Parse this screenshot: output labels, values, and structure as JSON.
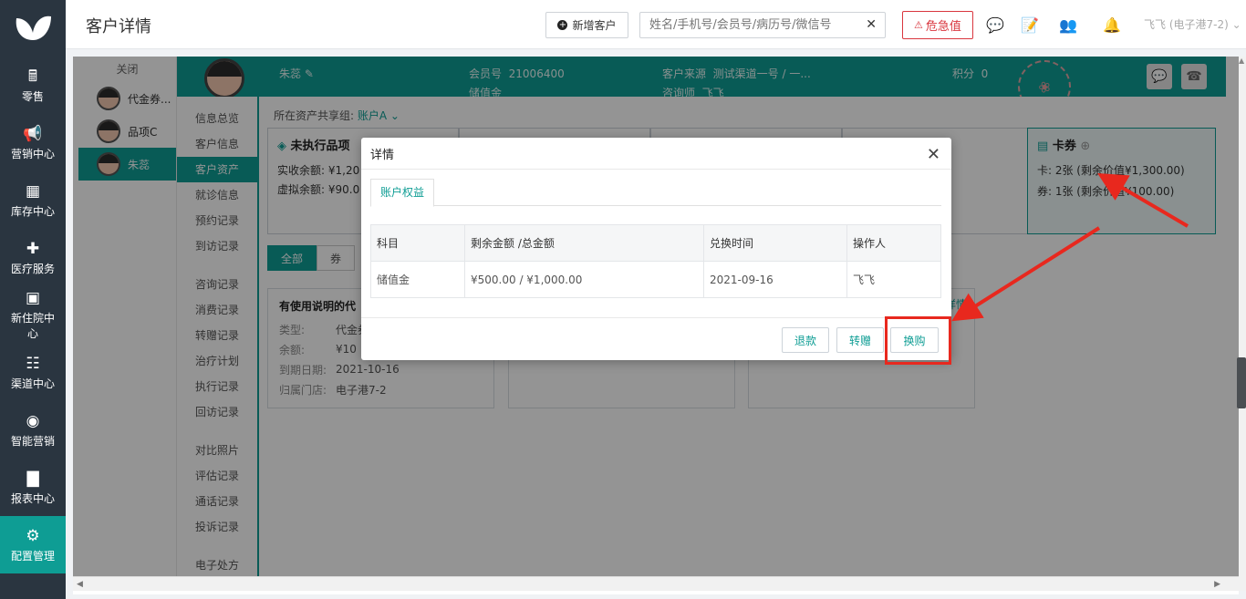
{
  "nav": {
    "items": [
      {
        "label": "零售",
        "icon": "retail-icon"
      },
      {
        "label": "营销中心",
        "icon": "megaphone-icon"
      },
      {
        "label": "库存中心",
        "icon": "grid-icon"
      },
      {
        "label": "医疗服务",
        "icon": "medical-kit-icon"
      },
      {
        "label": "新住院中心",
        "icon": "hospital-icon"
      },
      {
        "label": "渠道中心",
        "icon": "org-chart-icon"
      },
      {
        "label": "智能营销",
        "icon": "smart-marketing-icon"
      },
      {
        "label": "报表中心",
        "icon": "bar-chart-icon"
      },
      {
        "label": "配置管理",
        "icon": "gear-icon"
      }
    ]
  },
  "topbar": {
    "title": "客户详情",
    "new_customer": "新增客户",
    "search_placeholder": "姓名/手机号/会员号/病历号/微信号",
    "danger_button": "危急值",
    "user": "飞飞 (电子港7-2)"
  },
  "tabs": {
    "close": "关闭",
    "items": [
      "代金券...",
      "品项C",
      "朱蕊"
    ]
  },
  "customer": {
    "name": "朱蕊",
    "member_no_label": "会员号",
    "member_no": "21006400",
    "stored_value": "储值金",
    "source_label": "客户来源",
    "source": "测试渠道一号 / 一...",
    "advisor_label": "咨询师",
    "advisor": "飞飞",
    "points_label": "积分",
    "points": "0"
  },
  "submenu": {
    "group1": [
      "信息总览",
      "客户信息",
      "客户资产",
      "就诊信息",
      "预约记录",
      "到访记录"
    ],
    "group2": [
      "咨询记录",
      "消费记录",
      "转赠记录",
      "治疗计划",
      "执行记录",
      "回访记录"
    ],
    "group3": [
      "对比照片",
      "评估记录",
      "通话记录",
      "投诉记录"
    ],
    "group4": [
      "电子处方"
    ]
  },
  "assets": {
    "share_label": "所在资产共享组:",
    "share_account": "账户A",
    "unexecuted": {
      "title": "未执行品项",
      "paid": "实收余额: ¥1,20",
      "virtual": "虚拟余额: ¥90.0"
    },
    "coupons": {
      "title": "卡券",
      "card": "卡: 2张 (剩余价值¥1,300.00)",
      "voucher": "券: 1张 (剩余价值¥100.00)"
    },
    "filters": [
      "全部",
      "券"
    ],
    "record": {
      "title": "有使用说明的代",
      "rows": [
        {
          "k": "类型:",
          "v": "代金券"
        },
        {
          "k": "余额:",
          "v": "¥10"
        },
        {
          "k": "到期日期:",
          "v": "2021-10-16"
        },
        {
          "k": "归属门店:",
          "v": "电子港7-2"
        }
      ],
      "detail_link": "详情"
    }
  },
  "modal": {
    "title": "详情",
    "tab": "账户权益",
    "columns": [
      "科目",
      "剩余金额 /总金额",
      "兑换时间",
      "操作人"
    ],
    "rows": [
      [
        "储值金",
        "¥500.00 / ¥1,000.00",
        "2021-09-16",
        "飞飞"
      ]
    ],
    "buttons": {
      "refund": "退款",
      "transfer": "转赠",
      "exchange": "换购"
    }
  },
  "colors": {
    "brand": "#0e9d94",
    "nav": "#2a3540",
    "danger": "#d9363e",
    "annotation": "#e8281e"
  }
}
